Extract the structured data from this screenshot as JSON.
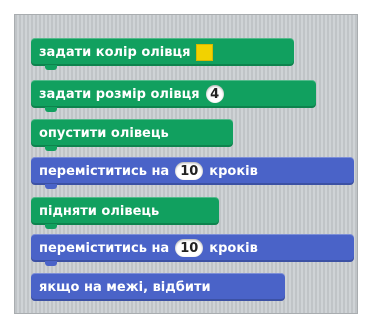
{
  "blocks": [
    {
      "category": "pen",
      "label": "задати колір олівця",
      "swatch_color": "#f2d200"
    },
    {
      "category": "pen",
      "label": "задати розмір олівця",
      "input": "4"
    },
    {
      "category": "pen",
      "label": "опустити олівець"
    },
    {
      "category": "motion",
      "label_before": "переміститись на",
      "input": "10",
      "label_after": "кроків"
    },
    {
      "category": "pen",
      "label": "підняти олівець"
    },
    {
      "category": "motion",
      "label_before": "переміститись на",
      "input": "10",
      "label_after": "кроків"
    },
    {
      "category": "motion",
      "label": "якщо на межі, відбити"
    }
  ],
  "colors": {
    "pen_block": "#11a05f",
    "motion_block": "#4a63c8",
    "background": "#cfd3d6"
  }
}
